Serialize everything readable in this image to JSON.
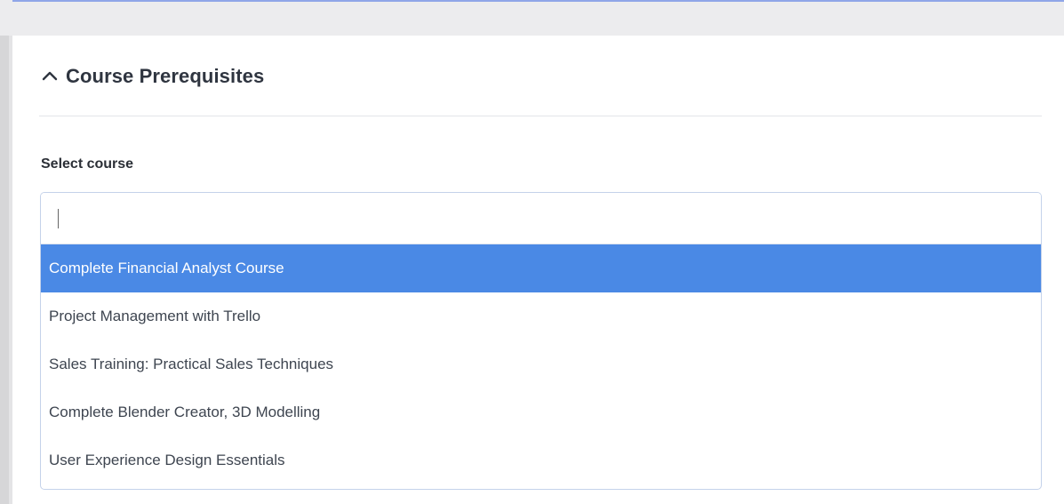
{
  "section": {
    "title": "Course Prerequisites",
    "icon": "chevron-up-icon"
  },
  "field": {
    "label": "Select course",
    "value": "",
    "placeholder": ""
  },
  "dropdown": {
    "highlighted_index": 0,
    "options": [
      {
        "label": "Complete Financial Analyst Course"
      },
      {
        "label": "Project Management with Trello"
      },
      {
        "label": "Sales Training: Practical Sales Techniques"
      },
      {
        "label": "Complete Blender Creator, 3D Modelling"
      },
      {
        "label": "User Experience Design Essentials"
      }
    ]
  },
  "colors": {
    "highlight": "#4a89e5",
    "highlight_text": "#ffffff",
    "option_text": "#3e4550",
    "title_text": "#2f3540"
  }
}
